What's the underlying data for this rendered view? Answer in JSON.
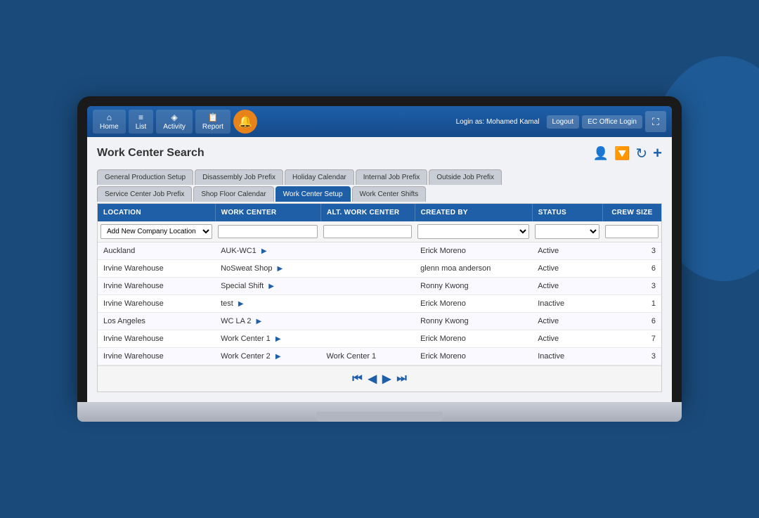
{
  "background": {
    "color": "#1a4a7a"
  },
  "nav": {
    "buttons": [
      {
        "label": "Home",
        "icon": "⌂"
      },
      {
        "label": "List",
        "icon": "≡"
      },
      {
        "label": "Activity",
        "icon": "◈"
      },
      {
        "label": "Report",
        "icon": "📋"
      }
    ],
    "alert_icon": "🔔",
    "user_info": "Login as: Mohamed Kamal",
    "logout_label": "Logout",
    "login_label": "EC Office Login",
    "expand_icon": "⛶"
  },
  "search": {
    "title": "Work Center Search",
    "icons": {
      "person": "👤",
      "filter": "🔽",
      "refresh": "↻",
      "add": "+"
    }
  },
  "tabs": {
    "row1": [
      {
        "label": "General Production Setup",
        "active": false
      },
      {
        "label": "Disassembly Job Prefix",
        "active": false
      },
      {
        "label": "Holiday Calendar",
        "active": false
      },
      {
        "label": "Internal Job Prefix",
        "active": false
      },
      {
        "label": "Outside Job Prefix",
        "active": false
      }
    ],
    "row2": [
      {
        "label": "Service Center Job Prefix",
        "active": false
      },
      {
        "label": "Shop Floor Calendar",
        "active": false
      },
      {
        "label": "Work Center Setup",
        "active": true
      },
      {
        "label": "Work Center Shifts",
        "active": false
      }
    ]
  },
  "table": {
    "columns": [
      {
        "label": "LOCATION",
        "key": "location"
      },
      {
        "label": "WORK CENTER",
        "key": "workcenter"
      },
      {
        "label": "ALT. WORK CENTER",
        "key": "altworkcenter"
      },
      {
        "label": "CREATED BY",
        "key": "createdby"
      },
      {
        "label": "STATUS",
        "key": "status"
      },
      {
        "label": "CREW SIZE",
        "key": "crewsize"
      }
    ],
    "filter": {
      "location_placeholder": "Add New Company Location",
      "workcenter_placeholder": "",
      "altworkcenter_placeholder": "",
      "createdby_placeholder": "",
      "status_placeholder": "",
      "crewsize_placeholder": ""
    },
    "rows": [
      {
        "location": "Auckland",
        "workcenter": "AUK-WC1",
        "altworkcenter": "",
        "createdby": "Erick Moreno",
        "status": "Active",
        "crewsize": "3"
      },
      {
        "location": "Irvine Warehouse",
        "workcenter": "NoSweat Shop",
        "altworkcenter": "",
        "createdby": "glenn moa anderson",
        "status": "Active",
        "crewsize": "6"
      },
      {
        "location": "Irvine Warehouse",
        "workcenter": "Special Shift",
        "altworkcenter": "",
        "createdby": "Ronny Kwong",
        "status": "Active",
        "crewsize": "3"
      },
      {
        "location": "Irvine Warehouse",
        "workcenter": "test",
        "altworkcenter": "",
        "createdby": "Erick Moreno",
        "status": "Inactive",
        "crewsize": "1"
      },
      {
        "location": "Los Angeles",
        "workcenter": "WC LA 2",
        "altworkcenter": "",
        "createdby": "Ronny Kwong",
        "status": "Active",
        "crewsize": "6"
      },
      {
        "location": "Irvine Warehouse",
        "workcenter": "Work Center 1",
        "altworkcenter": "",
        "createdby": "Erick Moreno",
        "status": "Active",
        "crewsize": "7"
      },
      {
        "location": "Irvine Warehouse",
        "workcenter": "Work Center 2",
        "altworkcenter": "Work Center 1",
        "createdby": "Erick Moreno",
        "status": "Inactive",
        "crewsize": "3"
      }
    ]
  },
  "pagination": {
    "first": "⏮",
    "prev": "◀",
    "next": "▶",
    "last": "⏭"
  }
}
